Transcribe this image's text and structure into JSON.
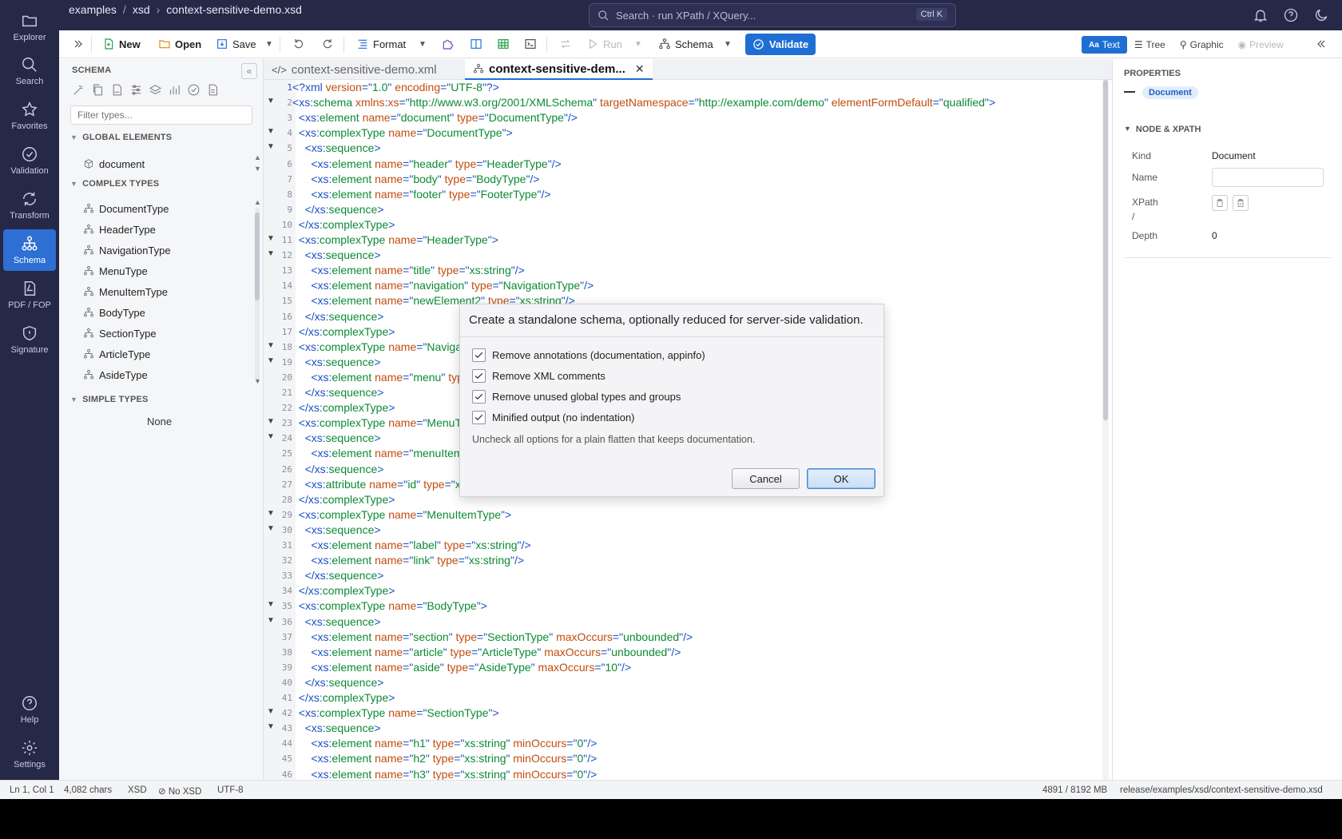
{
  "breadcrumb": [
    "examples",
    "xsd",
    "context-sensitive-demo.xsd"
  ],
  "search": {
    "placeholder": "Search · run XPath / XQuery...",
    "shortcut": "Ctrl K"
  },
  "rail": [
    {
      "label": "Explorer",
      "icon": "folder-icon"
    },
    {
      "label": "Search",
      "icon": "search-icon"
    },
    {
      "label": "Favorites",
      "icon": "star-icon"
    },
    {
      "label": "Validation",
      "icon": "check-circle-icon"
    },
    {
      "label": "Transform",
      "icon": "refresh-icon"
    },
    {
      "label": "Schema",
      "icon": "schema-tree-icon",
      "active": true
    },
    {
      "label": "PDF / FOP",
      "icon": "pdf-icon"
    },
    {
      "label": "Signature",
      "icon": "shield-icon"
    }
  ],
  "rail_bottom": [
    {
      "label": "Help",
      "icon": "help-icon"
    },
    {
      "label": "Settings",
      "icon": "gear-icon"
    }
  ],
  "toolbar": {
    "new": "New",
    "open": "Open",
    "save": "Save",
    "format": "Format",
    "run": "Run",
    "schema": "Schema",
    "validate": "Validate",
    "views": [
      "Text",
      "Tree",
      "Graphic",
      "Preview"
    ]
  },
  "schema_panel": {
    "title": "SCHEMA",
    "filter_placeholder": "Filter types...",
    "global_elements_title": "GLOBAL ELEMENTS",
    "global_elements": [
      "document"
    ],
    "complex_types_title": "COMPLEX TYPES",
    "complex_types": [
      "DocumentType",
      "HeaderType",
      "NavigationType",
      "MenuType",
      "MenuItemType",
      "BodyType",
      "SectionType",
      "ArticleType",
      "AsideType"
    ],
    "simple_types_title": "SIMPLE TYPES",
    "simple_types_empty": "None"
  },
  "tabs": [
    {
      "label": "context-sensitive-demo.xml",
      "active": false
    },
    {
      "label": "context-sensitive-dem...",
      "active": true
    }
  ],
  "code_lines": [
    "<?xml version=\"1.0\" encoding=\"UTF-8\"?>",
    "<xs:schema xmlns:xs=\"http://www.w3.org/2001/XMLSchema\" targetNamespace=\"http://example.com/demo\" elementFormDefault=\"qualified\">",
    "  <xs:element name=\"document\" type=\"DocumentType\"/>",
    "  <xs:complexType name=\"DocumentType\">",
    "    <xs:sequence>",
    "      <xs:element name=\"header\" type=\"HeaderType\"/>",
    "      <xs:element name=\"body\" type=\"BodyType\"/>",
    "      <xs:element name=\"footer\" type=\"FooterType\"/>",
    "    </xs:sequence>",
    "  </xs:complexType>",
    "  <xs:complexType name=\"HeaderType\">",
    "    <xs:sequence>",
    "      <xs:element name=\"title\" type=\"xs:string\"/>",
    "      <xs:element name=\"navigation\" type=\"NavigationType\"/>",
    "      <xs:element name=\"newElement2\" type=\"xs:string\"/>",
    "    </xs:sequence>",
    "  </xs:complexType>",
    "  <xs:complexType name=\"NavigationType\">",
    "    <xs:sequence>",
    "      <xs:element name=\"menu\" type=\"MenuType\"/>",
    "    </xs:sequence>",
    "  </xs:complexType>",
    "  <xs:complexType name=\"MenuType\">",
    "    <xs:sequence>",
    "      <xs:element name=\"menuItem\" type=\"MenuItemType\"/>",
    "    </xs:sequence>",
    "    <xs:attribute name=\"id\" type=\"xs:string\"/>",
    "  </xs:complexType>",
    "  <xs:complexType name=\"MenuItemType\">",
    "    <xs:sequence>",
    "      <xs:element name=\"label\" type=\"xs:string\"/>",
    "      <xs:element name=\"link\" type=\"xs:string\"/>",
    "    </xs:sequence>",
    "  </xs:complexType>",
    "  <xs:complexType name=\"BodyType\">",
    "    <xs:sequence>",
    "      <xs:element name=\"section\" type=\"SectionType\" maxOccurs=\"unbounded\"/>",
    "      <xs:element name=\"article\" type=\"ArticleType\" maxOccurs=\"unbounded\"/>",
    "      <xs:element name=\"aside\" type=\"AsideType\" maxOccurs=\"10\"/>",
    "    </xs:sequence>",
    "  </xs:complexType>",
    "  <xs:complexType name=\"SectionType\">",
    "    <xs:sequence>",
    "      <xs:element name=\"h1\" type=\"xs:string\" minOccurs=\"0\"/>",
    "      <xs:element name=\"h2\" type=\"xs:string\" minOccurs=\"0\"/>",
    "      <xs:element name=\"h3\" type=\"xs:string\" minOccurs=\"0\"/>"
  ],
  "fold_lines": [
    2,
    4,
    5,
    11,
    12,
    18,
    19,
    23,
    24,
    29,
    30,
    35,
    36,
    42,
    43
  ],
  "properties": {
    "title": "PROPERTIES",
    "badge": "Document",
    "section": "NODE & XPATH",
    "kind_label": "Kind",
    "kind_value": "Document",
    "name_label": "Name",
    "xpath_label": "XPath",
    "xpath_value": "/",
    "depth_label": "Depth",
    "depth_value": "0"
  },
  "dialog": {
    "title": "Create a standalone schema, optionally reduced for server-side validation.",
    "options": [
      {
        "label": "Remove annotations (documentation, appinfo)",
        "checked": true
      },
      {
        "label": "Remove XML comments",
        "checked": true
      },
      {
        "label": "Remove unused global types and groups",
        "checked": true
      },
      {
        "label": "Minified output (no indentation)",
        "checked": true
      }
    ],
    "hint": "Uncheck all options for a plain flatten that keeps documentation.",
    "cancel": "Cancel",
    "ok": "OK"
  },
  "status": {
    "position": "Ln 1, Col 1",
    "chars": "4,082 chars",
    "type": "XSD",
    "schema": "No XSD",
    "encoding": "UTF-8",
    "memory": "4891 / 8192 MB",
    "path": "release/examples/xsd/context-sensitive-demo.xsd"
  }
}
